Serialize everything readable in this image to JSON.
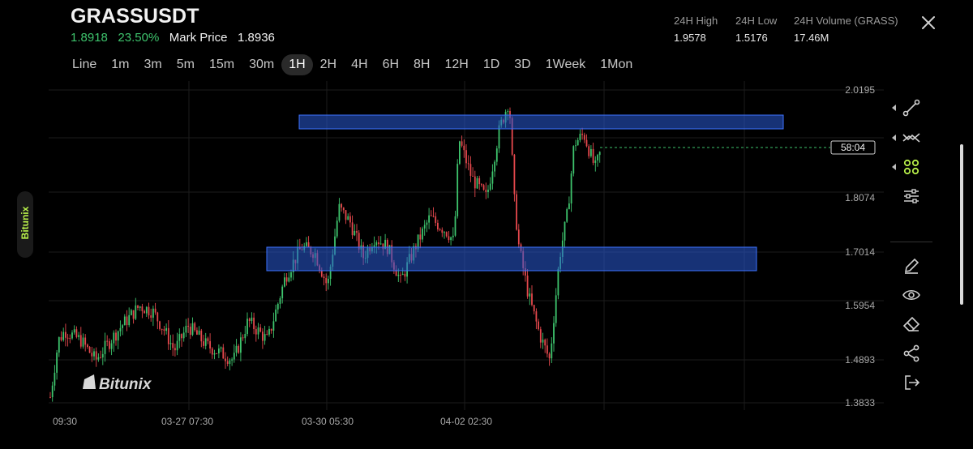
{
  "header": {
    "symbol": "GRASSUSDT",
    "last_price": "1.8918",
    "change_pct": "23.50%",
    "mark_label": "Mark Price",
    "mark_price": "1.8936",
    "stats": [
      {
        "label": "24H High",
        "value": "1.9578"
      },
      {
        "label": "24H Low",
        "value": "1.5176"
      },
      {
        "label": "24H Volume (GRASS)",
        "value": "17.46M"
      }
    ]
  },
  "intervals": [
    "Line",
    "1m",
    "3m",
    "5m",
    "15m",
    "30m",
    "1H",
    "2H",
    "4H",
    "6H",
    "8H",
    "12H",
    "1D",
    "3D",
    "1Week",
    "1Mon"
  ],
  "active_interval": "1H",
  "chart": {
    "watermark": "Bitunix",
    "countdown": "58:04",
    "price_axis": [
      "2.0195",
      "1.8074",
      "1.7014",
      "1.5954",
      "1.4893",
      "1.3833"
    ],
    "time_axis": [
      "09:30",
      "03-27 07:30",
      "03-30 05:30",
      "04-02 02:30"
    ],
    "colors": {
      "up": "#3ec46d",
      "down": "#e5484d",
      "zone": "#2a5bd7"
    }
  },
  "brand_tab": "Bitunix",
  "tools": [
    "trend-line-tool",
    "multi-line-tool",
    "pattern-tool",
    "indicator-settings",
    "draw-pencil",
    "visibility-eye",
    "eraser",
    "share",
    "exit"
  ]
}
